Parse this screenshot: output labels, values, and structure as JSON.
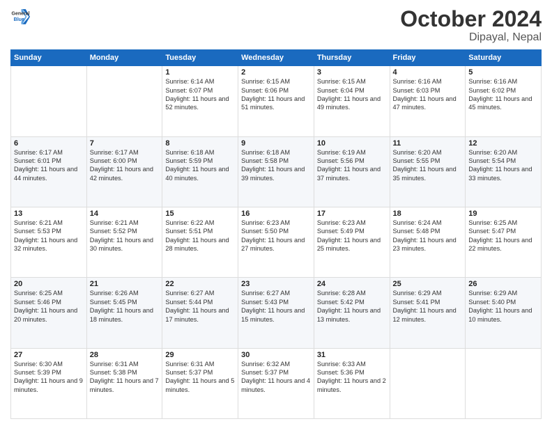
{
  "logo": {
    "line1": "General",
    "line2": "Blue"
  },
  "title": "October 2024",
  "location": "Dipayal, Nepal",
  "days_header": [
    "Sunday",
    "Monday",
    "Tuesday",
    "Wednesday",
    "Thursday",
    "Friday",
    "Saturday"
  ],
  "weeks": [
    [
      {
        "day": "",
        "detail": ""
      },
      {
        "day": "",
        "detail": ""
      },
      {
        "day": "1",
        "detail": "Sunrise: 6:14 AM\nSunset: 6:07 PM\nDaylight: 11 hours and 52 minutes."
      },
      {
        "day": "2",
        "detail": "Sunrise: 6:15 AM\nSunset: 6:06 PM\nDaylight: 11 hours and 51 minutes."
      },
      {
        "day": "3",
        "detail": "Sunrise: 6:15 AM\nSunset: 6:04 PM\nDaylight: 11 hours and 49 minutes."
      },
      {
        "day": "4",
        "detail": "Sunrise: 6:16 AM\nSunset: 6:03 PM\nDaylight: 11 hours and 47 minutes."
      },
      {
        "day": "5",
        "detail": "Sunrise: 6:16 AM\nSunset: 6:02 PM\nDaylight: 11 hours and 45 minutes."
      }
    ],
    [
      {
        "day": "6",
        "detail": "Sunrise: 6:17 AM\nSunset: 6:01 PM\nDaylight: 11 hours and 44 minutes."
      },
      {
        "day": "7",
        "detail": "Sunrise: 6:17 AM\nSunset: 6:00 PM\nDaylight: 11 hours and 42 minutes."
      },
      {
        "day": "8",
        "detail": "Sunrise: 6:18 AM\nSunset: 5:59 PM\nDaylight: 11 hours and 40 minutes."
      },
      {
        "day": "9",
        "detail": "Sunrise: 6:18 AM\nSunset: 5:58 PM\nDaylight: 11 hours and 39 minutes."
      },
      {
        "day": "10",
        "detail": "Sunrise: 6:19 AM\nSunset: 5:56 PM\nDaylight: 11 hours and 37 minutes."
      },
      {
        "day": "11",
        "detail": "Sunrise: 6:20 AM\nSunset: 5:55 PM\nDaylight: 11 hours and 35 minutes."
      },
      {
        "day": "12",
        "detail": "Sunrise: 6:20 AM\nSunset: 5:54 PM\nDaylight: 11 hours and 33 minutes."
      }
    ],
    [
      {
        "day": "13",
        "detail": "Sunrise: 6:21 AM\nSunset: 5:53 PM\nDaylight: 11 hours and 32 minutes."
      },
      {
        "day": "14",
        "detail": "Sunrise: 6:21 AM\nSunset: 5:52 PM\nDaylight: 11 hours and 30 minutes."
      },
      {
        "day": "15",
        "detail": "Sunrise: 6:22 AM\nSunset: 5:51 PM\nDaylight: 11 hours and 28 minutes."
      },
      {
        "day": "16",
        "detail": "Sunrise: 6:23 AM\nSunset: 5:50 PM\nDaylight: 11 hours and 27 minutes."
      },
      {
        "day": "17",
        "detail": "Sunrise: 6:23 AM\nSunset: 5:49 PM\nDaylight: 11 hours and 25 minutes."
      },
      {
        "day": "18",
        "detail": "Sunrise: 6:24 AM\nSunset: 5:48 PM\nDaylight: 11 hours and 23 minutes."
      },
      {
        "day": "19",
        "detail": "Sunrise: 6:25 AM\nSunset: 5:47 PM\nDaylight: 11 hours and 22 minutes."
      }
    ],
    [
      {
        "day": "20",
        "detail": "Sunrise: 6:25 AM\nSunset: 5:46 PM\nDaylight: 11 hours and 20 minutes."
      },
      {
        "day": "21",
        "detail": "Sunrise: 6:26 AM\nSunset: 5:45 PM\nDaylight: 11 hours and 18 minutes."
      },
      {
        "day": "22",
        "detail": "Sunrise: 6:27 AM\nSunset: 5:44 PM\nDaylight: 11 hours and 17 minutes."
      },
      {
        "day": "23",
        "detail": "Sunrise: 6:27 AM\nSunset: 5:43 PM\nDaylight: 11 hours and 15 minutes."
      },
      {
        "day": "24",
        "detail": "Sunrise: 6:28 AM\nSunset: 5:42 PM\nDaylight: 11 hours and 13 minutes."
      },
      {
        "day": "25",
        "detail": "Sunrise: 6:29 AM\nSunset: 5:41 PM\nDaylight: 11 hours and 12 minutes."
      },
      {
        "day": "26",
        "detail": "Sunrise: 6:29 AM\nSunset: 5:40 PM\nDaylight: 11 hours and 10 minutes."
      }
    ],
    [
      {
        "day": "27",
        "detail": "Sunrise: 6:30 AM\nSunset: 5:39 PM\nDaylight: 11 hours and 9 minutes."
      },
      {
        "day": "28",
        "detail": "Sunrise: 6:31 AM\nSunset: 5:38 PM\nDaylight: 11 hours and 7 minutes."
      },
      {
        "day": "29",
        "detail": "Sunrise: 6:31 AM\nSunset: 5:37 PM\nDaylight: 11 hours and 5 minutes."
      },
      {
        "day": "30",
        "detail": "Sunrise: 6:32 AM\nSunset: 5:37 PM\nDaylight: 11 hours and 4 minutes."
      },
      {
        "day": "31",
        "detail": "Sunrise: 6:33 AM\nSunset: 5:36 PM\nDaylight: 11 hours and 2 minutes."
      },
      {
        "day": "",
        "detail": ""
      },
      {
        "day": "",
        "detail": ""
      }
    ]
  ]
}
